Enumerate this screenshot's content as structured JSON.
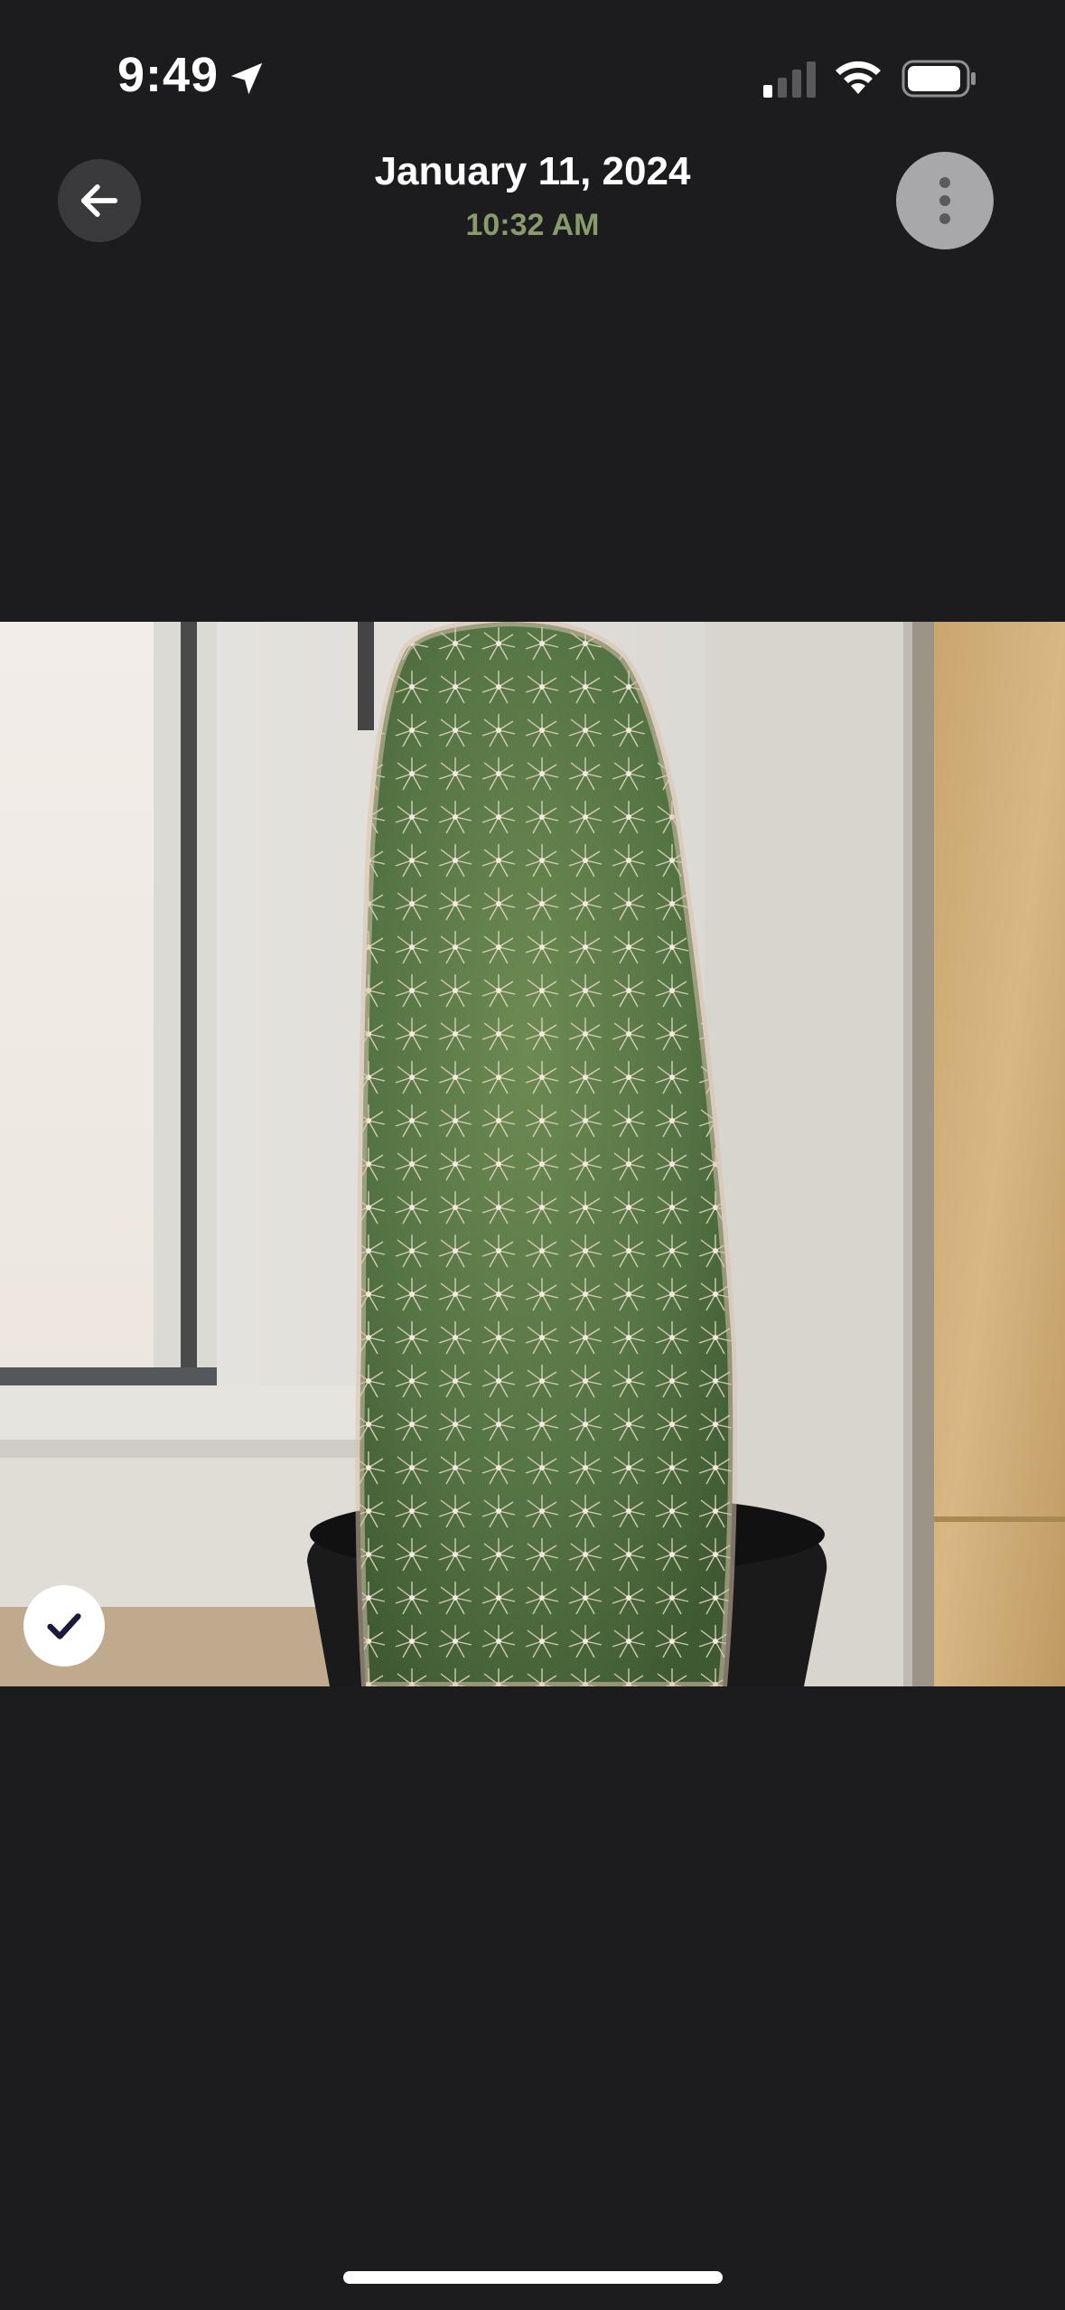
{
  "status_bar": {
    "time": "9:49"
  },
  "header": {
    "date": "January 11, 2024",
    "time": "10:32 AM"
  },
  "photo": {
    "subject": "cactus-photo",
    "selected": true
  },
  "colors": {
    "background": "#1c1c1e",
    "subtitle": "#8a9a6d",
    "back_button_bg": "#3a3a3c",
    "more_button_bg": "#a8a8aa"
  },
  "icons": {
    "back": "arrow-left-icon",
    "more": "vertical-ellipsis-icon",
    "check": "checkmark-icon",
    "location": "location-arrow-icon",
    "signal": "cellular-signal-icon",
    "wifi": "wifi-icon",
    "battery": "battery-icon"
  }
}
